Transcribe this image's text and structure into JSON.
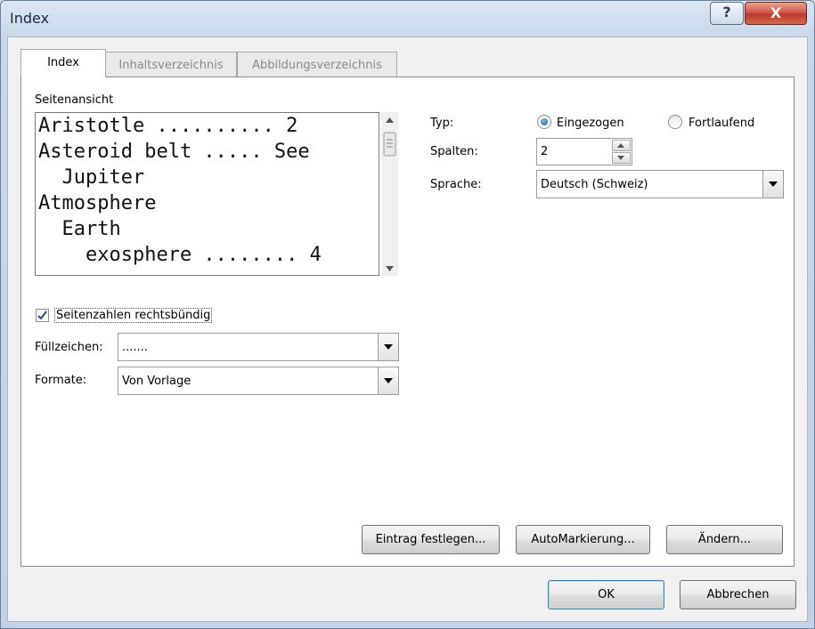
{
  "window": {
    "title": "Index",
    "help_label": "?",
    "close_label": "X"
  },
  "tabs": [
    {
      "label": "Index",
      "active": true
    },
    {
      "label": "Inhaltsverzeichnis",
      "active": false
    },
    {
      "label": "Abbildungsverzeichnis",
      "active": false
    }
  ],
  "preview": {
    "label": "Seitenansicht",
    "lines": [
      "Aristotle .......... 2",
      "Asteroid belt ..... See",
      "  Jupiter",
      "Atmosphere",
      "  Earth",
      "    exosphere ........ 4"
    ]
  },
  "options": {
    "typ_label": "Typ:",
    "typ_options": [
      {
        "label": "Eingezogen",
        "selected": true
      },
      {
        "label": "Fortlaufend",
        "selected": false
      }
    ],
    "spalten_label": "Spalten:",
    "spalten_value": "2",
    "sprache_label": "Sprache:",
    "sprache_value": "Deutsch (Schweiz)"
  },
  "right_align": {
    "label": "Seitenzahlen rechtsbündig",
    "checked": true
  },
  "fuellzeichen": {
    "label": "Füllzeichen:",
    "value": "......."
  },
  "formate": {
    "label": "Formate:",
    "value": "Von Vorlage"
  },
  "panel_buttons": {
    "eintrag": "Eintrag festlegen...",
    "automarkierung": "AutoMarkierung...",
    "aendern": "Ändern..."
  },
  "footer": {
    "ok": "OK",
    "cancel": "Abbrechen"
  }
}
